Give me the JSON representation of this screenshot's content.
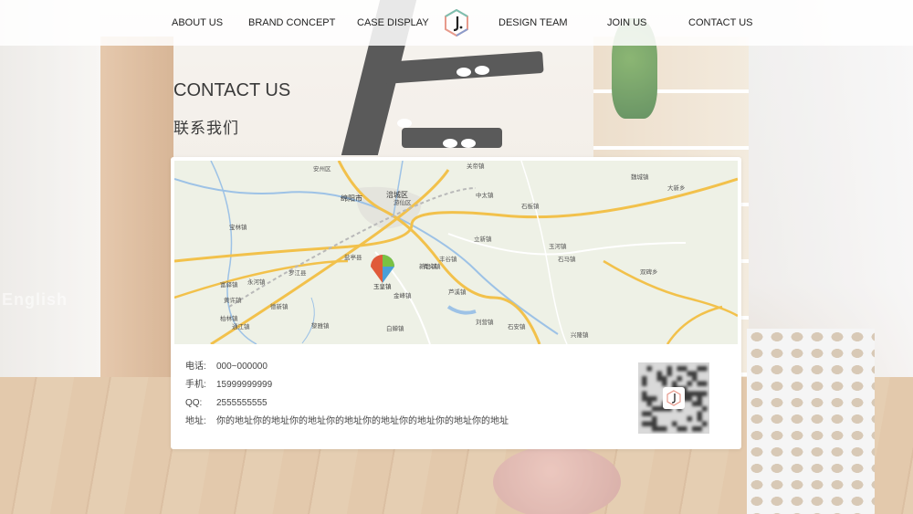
{
  "nav": {
    "items": [
      "ABOUT US",
      "BRAND CONCEPT",
      "CASE DISPLAY",
      "DESIGN TEAM",
      "JOIN US",
      "CONTACT US"
    ]
  },
  "page": {
    "title_en": "CONTACT US",
    "title_cn": "联系我们"
  },
  "map": {
    "labels": [
      "绵阳市",
      "涪城区",
      "游仙区",
      "安州区",
      "罗江县",
      "盐亭县",
      "青义镇",
      "金峰镇",
      "新皂镇",
      "立新镇",
      "关帝镇",
      "中太镇",
      "石板镇",
      "石马镇",
      "玉河镇",
      "白蝉镇",
      "黎雅镇",
      "兴隆镇",
      "富驿镇",
      "宝林镇",
      "柏林镇",
      "德新镇",
      "黄许镇",
      "通江镇",
      "永河镇",
      "双碑乡",
      "大新乡",
      "魏城镇",
      "丰谷镇",
      "芦溪镇",
      "刘营镇",
      "石安镇"
    ],
    "marker": "玉皇镇"
  },
  "contact": {
    "phone_label": "电话:",
    "phone": "000~000000",
    "mobile_label": "手机:",
    "mobile": "15999999999",
    "qq_label": "QQ:",
    "qq": "2555555555",
    "address_label": "地址:",
    "address": "你的地址你的地址你的地址你的地址你的地址你的地址你的地址你的地址"
  },
  "colors": {
    "nav_bg": "#ffffff",
    "text": "#3a3a3a",
    "road_major": "#f2c14b",
    "road_minor": "#ffffff",
    "water": "#9dc2e6"
  }
}
